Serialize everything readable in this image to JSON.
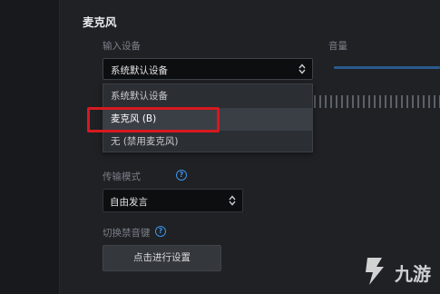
{
  "section": {
    "title": "麦克风"
  },
  "input_device": {
    "label": "输入设备",
    "selected": "系统默认设备",
    "options": [
      "系统默认设备",
      "麦克风 (B)",
      "无 (禁用麦克风)"
    ],
    "highlighted_option": "麦克风 (B)"
  },
  "volume": {
    "label": "音量"
  },
  "transmission": {
    "label": "传输模式",
    "selected": "自由发言"
  },
  "mute_key": {
    "label": "切换禁音键",
    "button_label": "点击进行设置"
  },
  "watermark": {
    "text": "九游"
  },
  "colors": {
    "accent": "#3b93e8",
    "highlight_border": "#d71920",
    "background": "#1f2125"
  },
  "icons": [
    "updown-arrows-icon",
    "help-icon",
    "watermark-logo-icon"
  ]
}
